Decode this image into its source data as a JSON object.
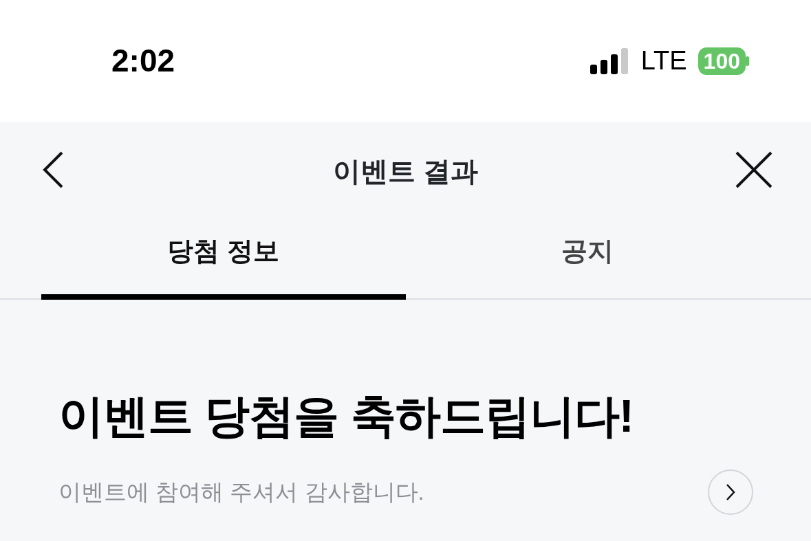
{
  "status_bar": {
    "time": "2:02",
    "network": "LTE",
    "battery": "100"
  },
  "header": {
    "title": "이벤트 결과"
  },
  "tabs": [
    {
      "label": "당첨 정보",
      "selected": true
    },
    {
      "label": "공지",
      "selected": false
    }
  ],
  "content": {
    "heading": "이벤트 당첨을 축하드립니다!",
    "subtitle": "이벤트에 참여해 주셔서 감사합니다."
  }
}
